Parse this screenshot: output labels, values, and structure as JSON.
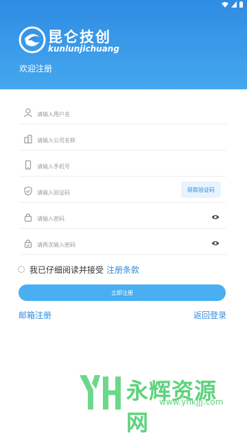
{
  "brand": {
    "name": "昆仑技创",
    "subtitle": "kunlunjichuang"
  },
  "header": {
    "welcome": "欢迎注册"
  },
  "form": {
    "username_placeholder": "请输入用户名",
    "company_placeholder": "请输入公司名称",
    "phone_placeholder": "请输入手机号",
    "code_placeholder": "请输入验证码",
    "get_code_label": "获取验证码",
    "password_placeholder": "请输入密码",
    "confirm_placeholder": "请再次输入密码",
    "agree_text": "我已仔细阅读并接受",
    "terms_link": "注册条款",
    "submit_label": "立即注册"
  },
  "links": {
    "email_register": "邮箱注册",
    "back_login": "返回登录"
  },
  "watermark": {
    "name": "永辉资源网",
    "url": "www.yhkjjj.com"
  },
  "colors": {
    "primary": "#2f8ce3",
    "button": "#4aaef2",
    "watermark": "#5ed27d"
  }
}
